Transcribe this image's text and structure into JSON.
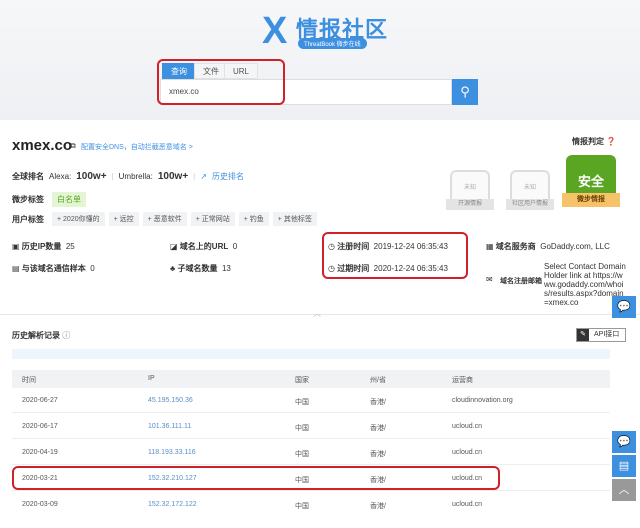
{
  "header": {
    "logo_title": "情报社区",
    "logo_sub": "ThreatBook 微步在线",
    "tabs": [
      "查询",
      "文件",
      "URL"
    ],
    "search_value": "xmex.co"
  },
  "domain": {
    "name": "xmex.co",
    "dns_link": "配置安全DNS，自动拦截恶意域名 >",
    "rank_label": "全球排名",
    "alexa_label": "Alexa:",
    "alexa_value": "100w+",
    "umbrella_label": "Umbrella:",
    "umbrella_value": "100w+",
    "history_rank": "历史排名",
    "tag_label": "微步标签",
    "tag": "白名单",
    "user_tag_label": "用户标签",
    "user_tags": [
      "+ 2020你懂的",
      "+ 远控",
      "+ 恶意软件",
      "+ 正常网站",
      "+ 钓鱼",
      "+ 其他标签"
    ]
  },
  "stats": [
    {
      "label": "历史IP数量",
      "value": "25"
    },
    {
      "label": "与该域名通信样本",
      "value": "0"
    },
    {
      "label": "域名上的URL",
      "value": "0"
    },
    {
      "label": "子域名数量",
      "value": "13"
    }
  ],
  "whois": {
    "reg_label": "注册时间",
    "reg_value": "2019-12-24 06:35:43",
    "exp_label": "过期时间",
    "exp_value": "2020-12-24 06:35:43",
    "registrar_label": "域名服务商",
    "registrar_value": "GoDaddy.com, LLC",
    "email_label": "域名注册邮箱",
    "email_value": "Select Contact Domain Holder link at https://www.godaddy.com/whois/results.aspx?domain=xmex.co"
  },
  "verdict": {
    "title": "情报判定",
    "badges": [
      {
        "status": "未知",
        "source": "开源情报"
      },
      {
        "status": "未知",
        "source": "社区用户情报"
      }
    ],
    "main_status": "安全",
    "main_source": "微步情报"
  },
  "history": {
    "title": "历史解析记录",
    "api_button": "API接口",
    "columns": [
      "时间",
      "IP",
      "国家",
      "州/省",
      "运营商"
    ],
    "rows": [
      [
        "2020-06-27",
        "45.195.150.36",
        "中国",
        "香港/",
        "cloudinnovation.org"
      ],
      [
        "2020-06-17",
        "101.36.111.11",
        "中国",
        "香港/",
        "ucloud.cn"
      ],
      [
        "2020-04-19",
        "118.193.33.116",
        "中国",
        "香港/",
        "ucloud.cn"
      ],
      [
        "2020-03-21",
        "152.32.210.127",
        "中国",
        "香港/",
        "ucloud.cn"
      ],
      [
        "2020-03-09",
        "152.32.172.122",
        "中国",
        "香港/",
        "ucloud.cn"
      ]
    ]
  }
}
